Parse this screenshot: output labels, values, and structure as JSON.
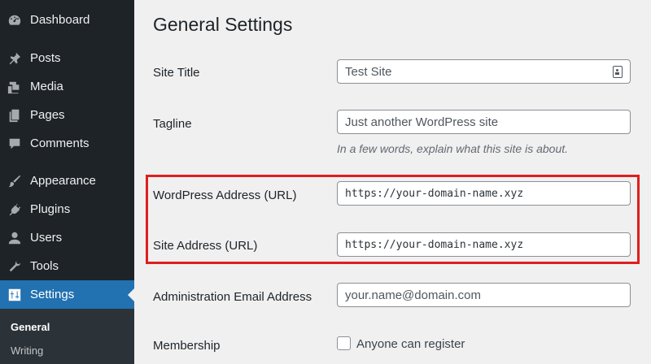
{
  "sidebar": {
    "items": [
      {
        "label": "Dashboard",
        "icon": "dashboard-icon"
      },
      {
        "label": "Posts",
        "icon": "pin-icon"
      },
      {
        "label": "Media",
        "icon": "media-icon"
      },
      {
        "label": "Pages",
        "icon": "pages-icon"
      },
      {
        "label": "Comments",
        "icon": "comment-icon"
      },
      {
        "label": "Appearance",
        "icon": "brush-icon"
      },
      {
        "label": "Plugins",
        "icon": "plug-icon"
      },
      {
        "label": "Users",
        "icon": "user-icon"
      },
      {
        "label": "Tools",
        "icon": "wrench-icon"
      },
      {
        "label": "Settings",
        "icon": "settings-icon"
      }
    ],
    "submenu": [
      "General",
      "Writing"
    ],
    "colors": {
      "background": "#1d2327",
      "active": "#2271b1",
      "submenu": "#2c3338"
    }
  },
  "main": {
    "title": "General Settings",
    "site_title": {
      "label": "Site Title",
      "value": "Test Site"
    },
    "tagline": {
      "label": "Tagline",
      "value": "Just another WordPress site",
      "hint": "In a few words, explain what this site is about."
    },
    "wp_address": {
      "label": "WordPress Address (URL)",
      "value": "https://your-domain-name.xyz"
    },
    "site_address": {
      "label": "Site Address (URL)",
      "value": "https://your-domain-name.xyz"
    },
    "admin_email": {
      "label": "Administration Email Address",
      "value": "your.name@domain.com"
    },
    "membership": {
      "label": "Membership",
      "checkbox_label": "Anyone can register",
      "checked": false
    },
    "highlight_color": "#e01e1e"
  }
}
